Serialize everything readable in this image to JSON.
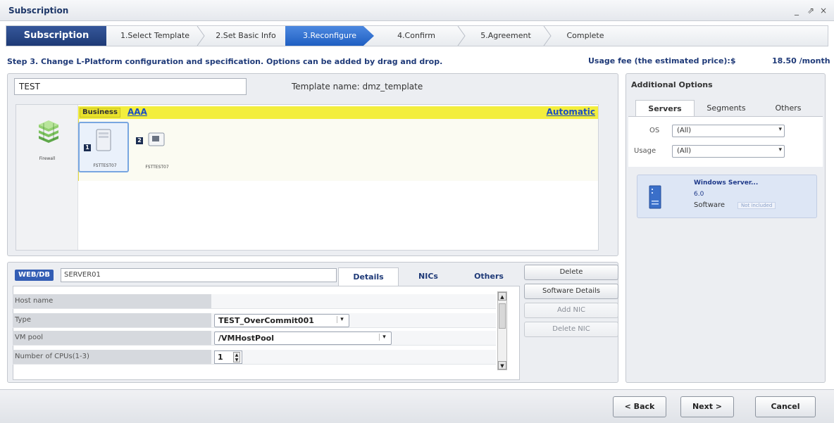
{
  "window": {
    "title": "Subscription",
    "controls": [
      "_",
      "⇗",
      "×"
    ]
  },
  "wizard": {
    "steps": [
      {
        "label": "Subscription"
      },
      {
        "label": "1.Select Template"
      },
      {
        "label": "2.Set Basic Info"
      },
      {
        "label": "3.Reconfigure"
      },
      {
        "label": "4.Confirm"
      },
      {
        "label": "5.Agreement"
      },
      {
        "label": "Complete"
      }
    ],
    "active_step": "3.Reconfigure"
  },
  "step_text": "Step 3. Change L-Platform configuration and specification. Options can be added by drag and drop.",
  "usage": {
    "label": "Usage fee (the estimated price):$",
    "value": "18.50 /month"
  },
  "platform": {
    "name": "TEST",
    "template_name": "Template name: dmz_template",
    "firewall_label": "Firewall",
    "segment": {
      "tag": "Business",
      "name": "AAA",
      "mode": "Automatic"
    },
    "servers": [
      {
        "num": "1",
        "label": "FSTTEST07"
      },
      {
        "num": "2",
        "label": "FSTTEST07"
      }
    ]
  },
  "server_detail": {
    "tag": "WEB/DB",
    "name": "SERVER01",
    "tabs": [
      "Details",
      "NICs",
      "Others"
    ],
    "rows": [
      {
        "label": "Host name",
        "value": ""
      },
      {
        "label": "Type",
        "value": "TEST_OverCommit001"
      },
      {
        "label": "VM pool",
        "value": "/VMHostPool"
      },
      {
        "label": "Number of CPUs(1-3)",
        "value": "1"
      }
    ],
    "buttons": {
      "delete": "Delete",
      "software_details": "Software Details",
      "add_nic": "Add NIC",
      "delete_nic": "Delete NIC"
    }
  },
  "additional": {
    "title": "Additional Options",
    "tabs": [
      "Servers",
      "Segments",
      "Others"
    ],
    "os_label": "OS",
    "os_value": "(All)",
    "usage_label": "Usage",
    "usage_value": "(All)",
    "software": {
      "title": "Windows Server...",
      "version": "6.0",
      "type": "Software",
      "badge": "Not included"
    }
  },
  "footer": {
    "back": "< Back",
    "next": "Next >",
    "cancel": "Cancel"
  }
}
